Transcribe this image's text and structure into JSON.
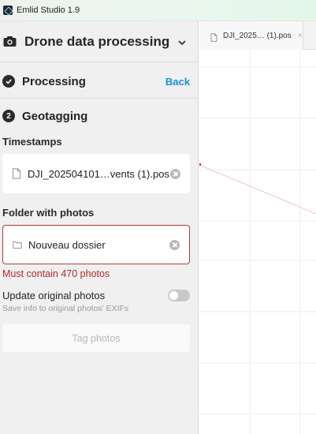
{
  "window": {
    "title": "Emlid Studio 1.9"
  },
  "project": {
    "title": "Drone data processing"
  },
  "steps": [
    {
      "badge": "",
      "label": "Processing",
      "action": "Back"
    },
    {
      "badge": "2",
      "label": "Geotagging"
    }
  ],
  "timestamps": {
    "label": "Timestamps",
    "file": "DJI_202504101…vents (1).pos"
  },
  "folder": {
    "label": "Folder with photos",
    "value": "Nouveau dossier",
    "error": "Must contain 470 photos"
  },
  "update_option": {
    "label": "Update original photos",
    "description": "Save info to original photos' EXIFs",
    "enabled": false
  },
  "tag_button": {
    "label": "Tag photos"
  },
  "tab": {
    "label": "DJI_2025… (1).pos",
    "close": "×"
  },
  "colors": {
    "accent": "#1a8fd6",
    "error": "#b02a2a",
    "sidebar_bg": "#f0f0f0"
  }
}
